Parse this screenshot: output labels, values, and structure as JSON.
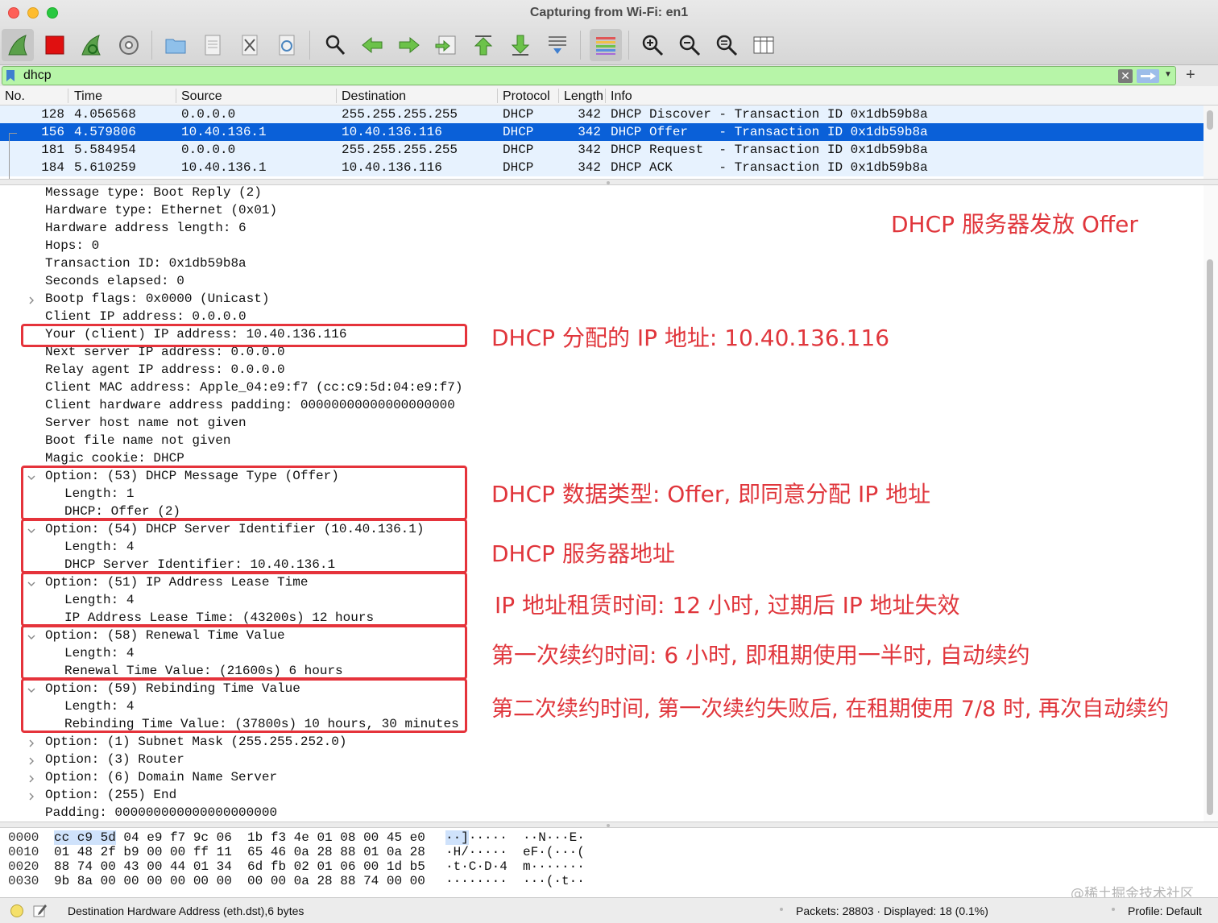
{
  "window": {
    "title": "Capturing from Wi-Fi: en1"
  },
  "toolbar": {
    "buttons": [
      {
        "name": "start-capture-icon"
      },
      {
        "name": "stop-capture-icon"
      },
      {
        "name": "restart-capture-icon"
      },
      {
        "name": "capture-options-icon"
      },
      {
        "name": "open-file-icon"
      },
      {
        "name": "save-file-icon"
      },
      {
        "name": "close-file-icon"
      },
      {
        "name": "reload-file-icon"
      },
      {
        "name": "find-packet-icon"
      },
      {
        "name": "go-back-icon"
      },
      {
        "name": "go-forward-icon"
      },
      {
        "name": "go-to-packet-icon"
      },
      {
        "name": "go-first-icon"
      },
      {
        "name": "go-last-icon"
      },
      {
        "name": "autoscroll-icon"
      },
      {
        "name": "colorize-icon"
      },
      {
        "name": "zoom-in-icon"
      },
      {
        "name": "zoom-out-icon"
      },
      {
        "name": "zoom-normal-icon"
      },
      {
        "name": "resize-columns-icon"
      }
    ]
  },
  "filter": {
    "value": "dhcp",
    "bookmark_icon": "bookmark-icon",
    "clear_icon": "clear-icon",
    "apply_icon": "apply-arrow-icon",
    "add_label": "+"
  },
  "packet_list": {
    "columns": [
      "No.",
      "Time",
      "Source",
      "Destination",
      "Protocol",
      "Length",
      "Info"
    ],
    "rows": [
      {
        "no": "128",
        "time": "4.056568",
        "src": "0.0.0.0",
        "dst": "255.255.255.255",
        "proto": "DHCP",
        "len": "342",
        "info": "DHCP Discover - Transaction ID 0x1db59b8a",
        "selected": false
      },
      {
        "no": "156",
        "time": "4.579806",
        "src": "10.40.136.1",
        "dst": "10.40.136.116",
        "proto": "DHCP",
        "len": "342",
        "info": "DHCP Offer    - Transaction ID 0x1db59b8a",
        "selected": true
      },
      {
        "no": "181",
        "time": "5.584954",
        "src": "0.0.0.0",
        "dst": "255.255.255.255",
        "proto": "DHCP",
        "len": "342",
        "info": "DHCP Request  - Transaction ID 0x1db59b8a",
        "selected": false
      },
      {
        "no": "184",
        "time": "5.610259",
        "src": "10.40.136.1",
        "dst": "10.40.136.116",
        "proto": "DHCP",
        "len": "342",
        "info": "DHCP ACK      - Transaction ID 0x1db59b8a",
        "selected": false
      }
    ],
    "row_color": "#e7f2fe",
    "selected_color": "#0a60d8"
  },
  "details": {
    "lines": [
      {
        "text": "Message type: Boot Reply (2)",
        "indent": 1,
        "expander": "none"
      },
      {
        "text": "Hardware type: Ethernet (0x01)",
        "indent": 1,
        "expander": "none"
      },
      {
        "text": "Hardware address length: 6",
        "indent": 1,
        "expander": "none"
      },
      {
        "text": "Hops: 0",
        "indent": 1,
        "expander": "none"
      },
      {
        "text": "Transaction ID: 0x1db59b8a",
        "indent": 1,
        "expander": "none"
      },
      {
        "text": "Seconds elapsed: 0",
        "indent": 1,
        "expander": "none"
      },
      {
        "text": "Bootp flags: 0x0000 (Unicast)",
        "indent": 1,
        "expander": "collapsed"
      },
      {
        "text": "Client IP address: 0.0.0.0",
        "indent": 1,
        "expander": "none"
      },
      {
        "text": "Your (client) IP address: 10.40.136.116",
        "indent": 1,
        "expander": "none"
      },
      {
        "text": "Next server IP address: 0.0.0.0",
        "indent": 1,
        "expander": "none"
      },
      {
        "text": "Relay agent IP address: 0.0.0.0",
        "indent": 1,
        "expander": "none"
      },
      {
        "text": "Client MAC address: Apple_04:e9:f7 (cc:c9:5d:04:e9:f7)",
        "indent": 1,
        "expander": "none"
      },
      {
        "text": "Client hardware address padding: 00000000000000000000",
        "indent": 1,
        "expander": "none"
      },
      {
        "text": "Server host name not given",
        "indent": 1,
        "expander": "none"
      },
      {
        "text": "Boot file name not given",
        "indent": 1,
        "expander": "none"
      },
      {
        "text": "Magic cookie: DHCP",
        "indent": 1,
        "expander": "none"
      },
      {
        "text": "Option: (53) DHCP Message Type (Offer)",
        "indent": 1,
        "expander": "expanded"
      },
      {
        "text": "Length: 1",
        "indent": 2,
        "expander": "none"
      },
      {
        "text": "DHCP: Offer (2)",
        "indent": 2,
        "expander": "none"
      },
      {
        "text": "Option: (54) DHCP Server Identifier (10.40.136.1)",
        "indent": 1,
        "expander": "expanded"
      },
      {
        "text": "Length: 4",
        "indent": 2,
        "expander": "none"
      },
      {
        "text": "DHCP Server Identifier: 10.40.136.1",
        "indent": 2,
        "expander": "none"
      },
      {
        "text": "Option: (51) IP Address Lease Time",
        "indent": 1,
        "expander": "expanded"
      },
      {
        "text": "Length: 4",
        "indent": 2,
        "expander": "none"
      },
      {
        "text": "IP Address Lease Time: (43200s) 12 hours",
        "indent": 2,
        "expander": "none"
      },
      {
        "text": "Option: (58) Renewal Time Value",
        "indent": 1,
        "expander": "expanded"
      },
      {
        "text": "Length: 4",
        "indent": 2,
        "expander": "none"
      },
      {
        "text": "Renewal Time Value: (21600s) 6 hours",
        "indent": 2,
        "expander": "none"
      },
      {
        "text": "Option: (59) Rebinding Time Value",
        "indent": 1,
        "expander": "expanded"
      },
      {
        "text": "Length: 4",
        "indent": 2,
        "expander": "none"
      },
      {
        "text": "Rebinding Time Value: (37800s) 10 hours, 30 minutes",
        "indent": 2,
        "expander": "none"
      },
      {
        "text": "Option: (1) Subnet Mask (255.255.252.0)",
        "indent": 1,
        "expander": "collapsed"
      },
      {
        "text": "Option: (3) Router",
        "indent": 1,
        "expander": "collapsed"
      },
      {
        "text": "Option: (6) Domain Name Server",
        "indent": 1,
        "expander": "collapsed"
      },
      {
        "text": "Option: (255) End",
        "indent": 1,
        "expander": "collapsed"
      },
      {
        "text": "Padding: 000000000000000000000",
        "indent": 1,
        "expander": "none"
      }
    ],
    "highlight_color": "#e5333b",
    "annotations": [
      "DHCP 服务器发放 Offer",
      "DHCP 分配的 IP 地址: 10.40.136.116",
      "DHCP 数据类型: Offer, 即同意分配 IP 地址",
      "DHCP 服务器地址",
      "IP 地址租赁时间: 12 小时, 过期后 IP 地址失效",
      "第一次续约时间: 6 小时, 即租期使用一半时, 自动续约",
      "第二次续约时间, 第一次续约失败后, 在租期使用 7/8 时, 再次自动续约"
    ],
    "annotation_color": "#e0363c"
  },
  "hex": {
    "rows": [
      {
        "offset": "0000",
        "hi": "cc c9 5d",
        "bytes": " 04 e9 f7 9c 06  1b f3 4e 01 08 00 45 e0",
        "ascii_hi": "··]",
        "ascii": "·····  ··N···E·"
      },
      {
        "offset": "0010",
        "hi": "",
        "bytes": "01 48 2f b9 00 00 ff 11  65 46 0a 28 88 01 0a 28",
        "ascii_hi": "",
        "ascii": "·H/·····  eF·(···("
      },
      {
        "offset": "0020",
        "hi": "",
        "bytes": "88 74 00 43 00 44 01 34  6d fb 02 01 06 00 1d b5",
        "ascii_hi": "",
        "ascii": "·t·C·D·4  m·······"
      },
      {
        "offset": "0030",
        "hi": "",
        "bytes": "9b 8a 00 00 00 00 00 00  00 00 0a 28 88 74 00 00",
        "ascii_hi": "",
        "ascii": "········  ···(·t··"
      }
    ],
    "watermark": "@稀土掘金技术社区"
  },
  "status": {
    "field_info": "Destination Hardware Address (eth.dst),6 bytes",
    "packets": "Packets: 28803 · Displayed: 18 (0.1%)",
    "profile": "Profile: Default",
    "led_color": "#f5e06a"
  }
}
